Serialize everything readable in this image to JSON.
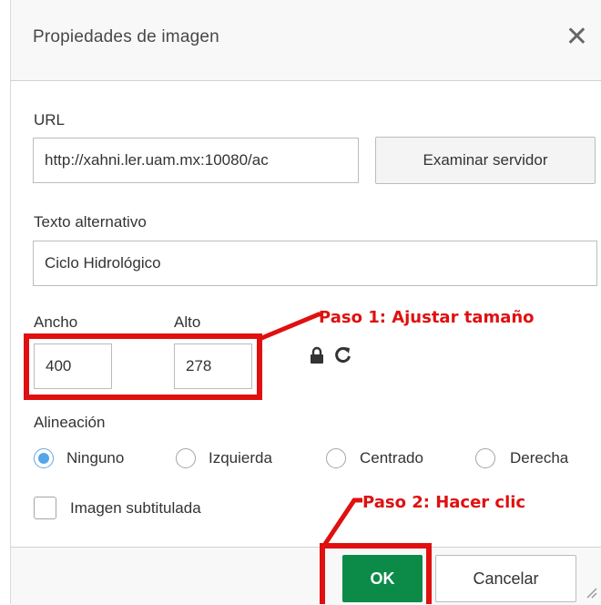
{
  "dialog": {
    "title": "Propiedades de imagen",
    "close_icon": "close-icon"
  },
  "url": {
    "label": "URL",
    "value": "http://xahni.ler.uam.mx:10080/ac",
    "browse_button": "Examinar servidor"
  },
  "alt_text": {
    "label": "Texto alternativo",
    "value": "Ciclo Hidrológico"
  },
  "size": {
    "width_label": "Ancho",
    "width_value": "400",
    "height_label": "Alto",
    "height_value": "278",
    "lock_icon": "lock-icon",
    "reset_icon": "reset-icon"
  },
  "alignment": {
    "label": "Alineación",
    "options": [
      "Ninguno",
      "Izquierda",
      "Centrado",
      "Derecha"
    ],
    "selected": "Ninguno"
  },
  "caption": {
    "label": "Imagen subtitulada",
    "checked": false
  },
  "footer": {
    "ok_label": "OK",
    "cancel_label": "Cancelar"
  },
  "annotations": {
    "step1": "Paso 1: Ajustar tamaño",
    "step2": "Paso 2: Hacer clic",
    "color": "#e01010"
  },
  "colors": {
    "ok_button": "#0c8a48",
    "radio_selected": "#55a6e8"
  }
}
